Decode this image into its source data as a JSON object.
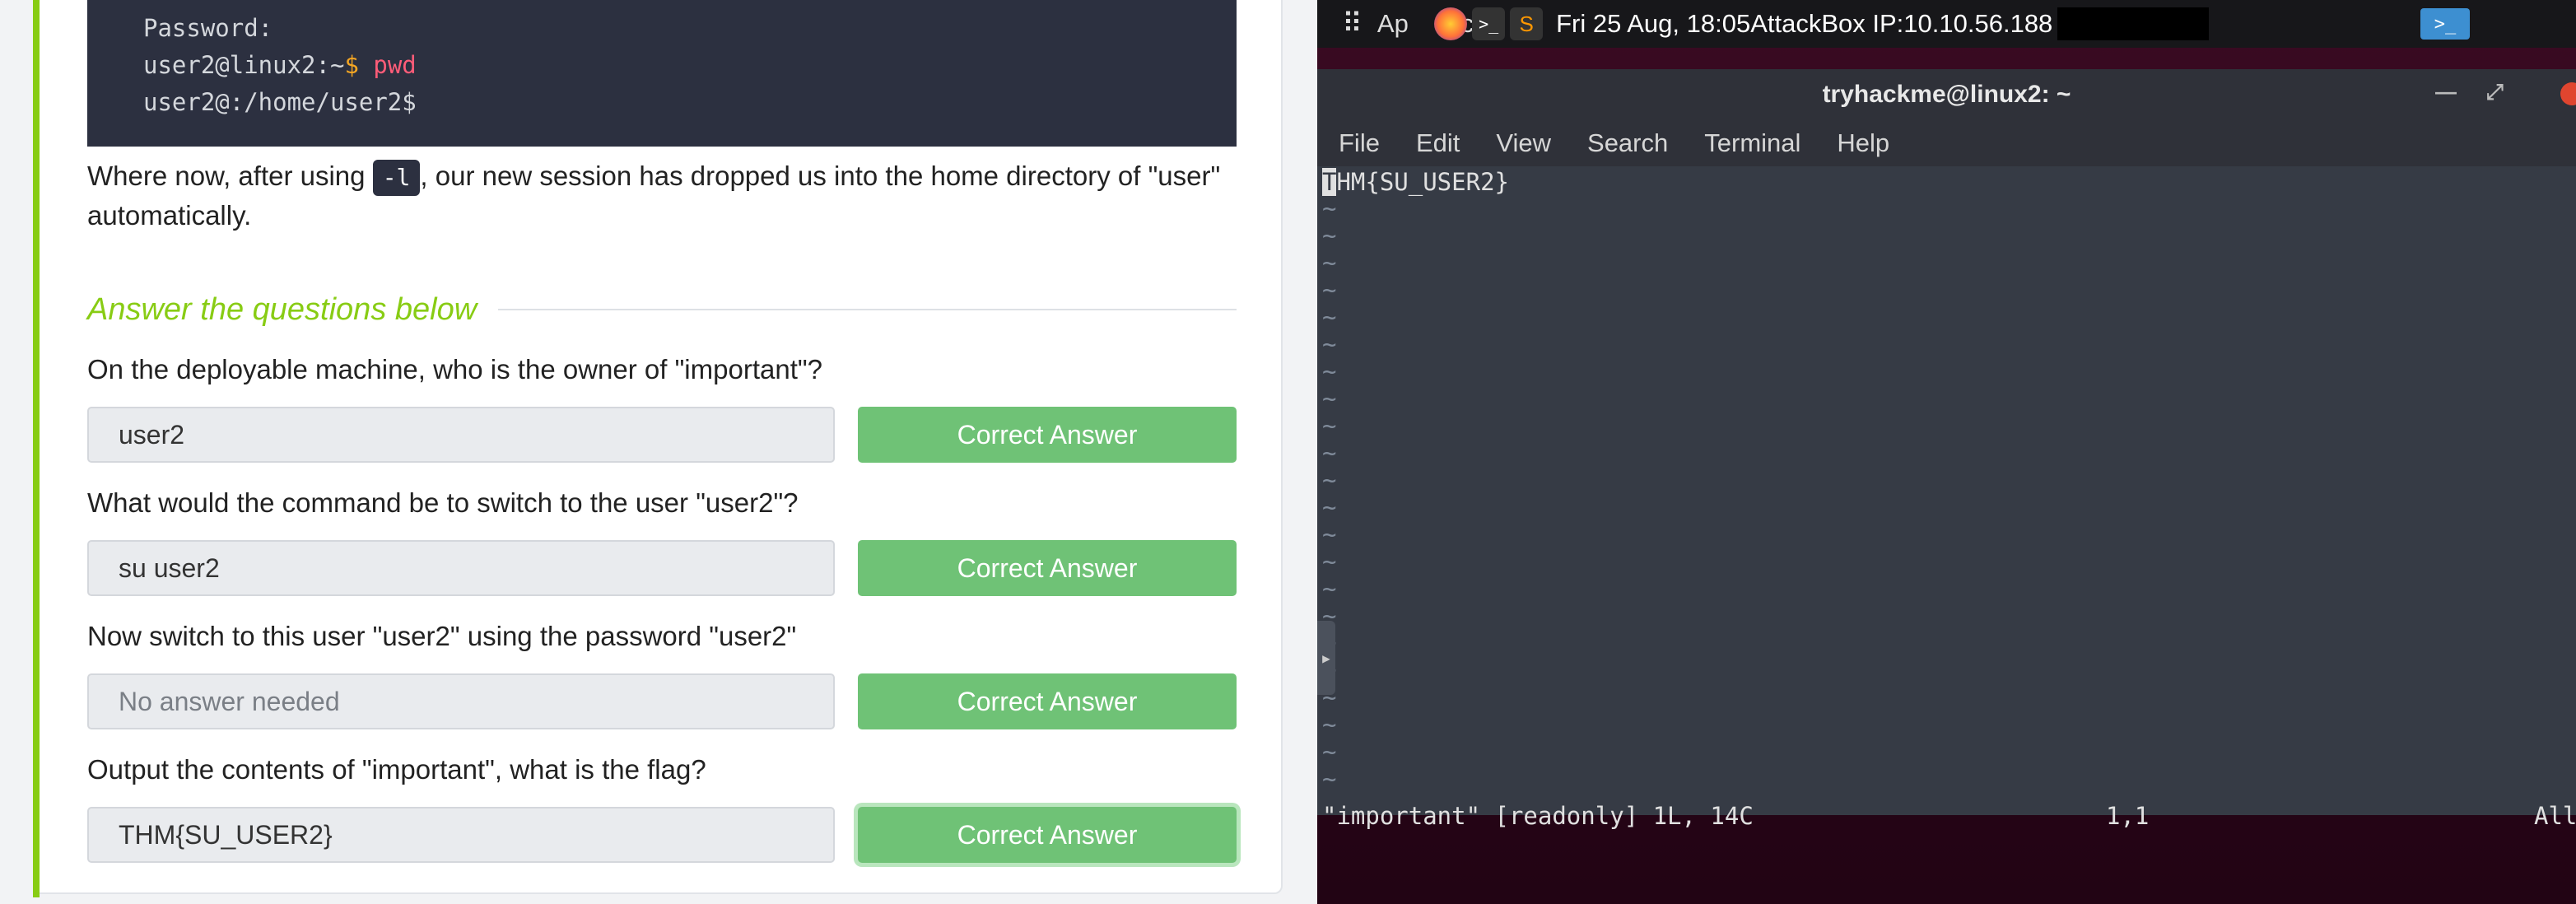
{
  "task": {
    "code_lines": [
      {
        "text": "Password:"
      },
      {
        "prefix": "user2@linux2:~$ ",
        "cmd": "pwd"
      },
      {
        "text": "user2@:/home/user2$"
      }
    ],
    "explanation": {
      "before": "Where now, after using ",
      "code": "-l",
      "after": ", our new session has dropped us into the home directory of \"user\" automatically."
    },
    "answer_heading": "Answer the questions below",
    "questions": [
      {
        "text": "On the deployable machine, who is the owner of \"important\"?",
        "answer": "user2",
        "button": "Correct Answer"
      },
      {
        "text": "What would the command be to switch to the user \"user2\"?",
        "answer": "su user2",
        "button": "Correct Answer"
      },
      {
        "text": "Now switch to this user \"user2\" using the password \"user2\"",
        "answer": "No answer needed",
        "button": "Correct Answer"
      },
      {
        "text": "Output the contents of \"important\", what is the flag?",
        "answer": "THM{SU_USER2}",
        "button": "Correct Answer"
      }
    ]
  },
  "desktop": {
    "apps_icon": "grid-icon",
    "apps_label": "Ap",
    "apps_label_tail": "lic",
    "clock": "Fri 25 Aug, 18:05",
    "attackbox": "AttackBox IP:10.10.56.188",
    "terminal": {
      "title": "tryhackme@linux2: ~",
      "menu": [
        "File",
        "Edit",
        "View",
        "Search",
        "Terminal",
        "Help"
      ],
      "first_char": "T",
      "content_rest": "HM{SU_USER2}",
      "tilde": "~",
      "status_file": "\"important\" [readonly] 1L, 14C",
      "status_pos": "1,1",
      "status_all": "All"
    }
  },
  "colors": {
    "accent": "#88cc14",
    "correct": "#6fc276",
    "code_bg": "#2c3040",
    "terminal_bg": "#363b45"
  }
}
